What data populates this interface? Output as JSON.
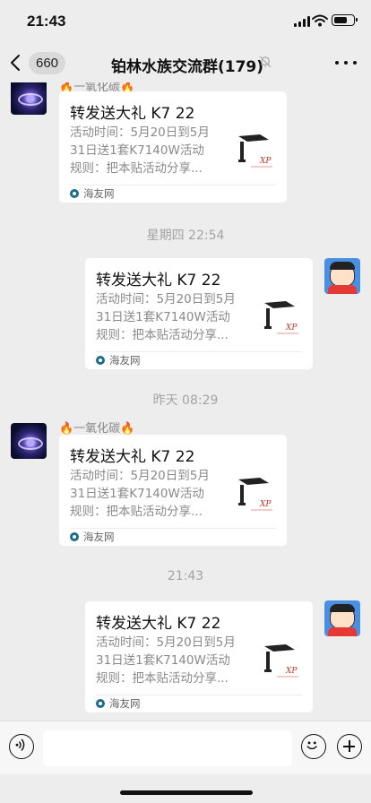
{
  "status_bar": {
    "time": "21:43",
    "icons": [
      "signal-icon",
      "wifi-icon",
      "battery-icon"
    ],
    "battery_level": 0.7
  },
  "header": {
    "back_icon": "chevron-left-icon",
    "unread_count": "660",
    "title": "铂林水族交流群(179)",
    "mute_icon": "mute-bell-icon",
    "more_icon": "more-dots-icon"
  },
  "messages": [
    {
      "side": "left",
      "sender": "🔥一氧化碳🔥",
      "card": {
        "title": "转发送大礼 K7 22",
        "desc_lines": [
          "活动时间：5月20日到5月",
          "31日送1套K7140W活动",
          "规则：把本贴活动分享..."
        ],
        "thumb_icon": "aquarium-light-icon",
        "source": "海友网"
      }
    },
    {
      "type": "time",
      "text": "星期四 22:54"
    },
    {
      "side": "right",
      "card": {
        "title": "转发送大礼 K7 22",
        "desc_lines": [
          "活动时间：5月20日到5月",
          "31日送1套K7140W活动",
          "规则：把本贴活动分享..."
        ],
        "thumb_icon": "aquarium-light-icon",
        "source": "海友网"
      }
    },
    {
      "type": "time",
      "text": "昨天 08:29"
    },
    {
      "side": "left",
      "sender": "🔥一氧化碳🔥",
      "card": {
        "title": "转发送大礼 K7 22",
        "desc_lines": [
          "活动时间：5月20日到5月",
          "31日送1套K7140W活动",
          "规则：把本贴活动分享..."
        ],
        "thumb_icon": "aquarium-light-icon",
        "source": "海友网"
      }
    },
    {
      "type": "time",
      "text": "21:43"
    },
    {
      "side": "right",
      "card": {
        "title": "转发送大礼 K7 22",
        "desc_lines": [
          "活动时间：5月20日到5月",
          "31日送1套K7140W活动",
          "规则：把本贴活动分享..."
        ],
        "thumb_icon": "aquarium-light-icon",
        "source": "海友网"
      }
    }
  ],
  "input_bar": {
    "voice_icon": "voice-icon",
    "input_value": "",
    "emoji_icon": "emoji-icon",
    "plus_icon": "plus-icon"
  },
  "colors": {
    "background": "#ededed",
    "card": "#ffffff",
    "muted_text": "#8a8a8a",
    "source_dot": "#1e6b8a"
  }
}
